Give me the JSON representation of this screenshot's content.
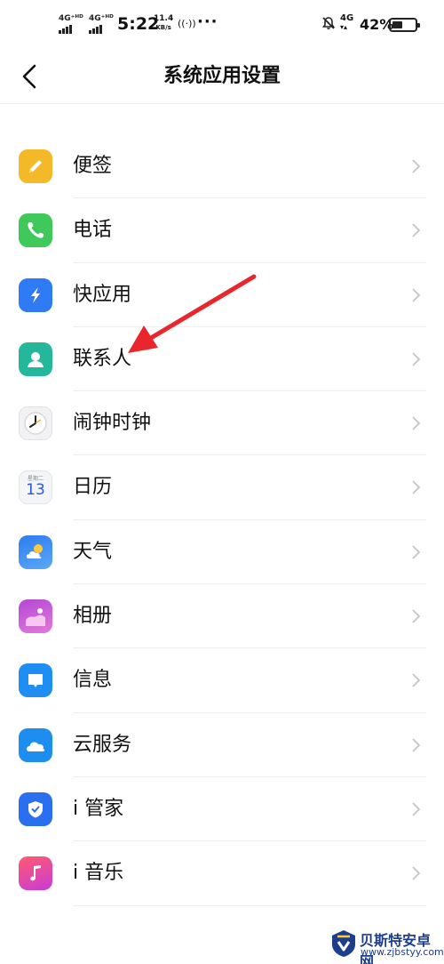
{
  "status": {
    "sim1": "4G⁺ᴴᴰ",
    "sim2": "4G⁺ᴴᴰ",
    "time": "5:22",
    "speed_value": "11.4",
    "speed_unit": "KB/s",
    "network": "4G",
    "battery": "42%"
  },
  "header": {
    "title": "系统应用设置"
  },
  "items": [
    {
      "label": "便签",
      "icon": "note-icon"
    },
    {
      "label": "电话",
      "icon": "phone-icon"
    },
    {
      "label": "快应用",
      "icon": "quick-app-icon"
    },
    {
      "label": "联系人",
      "icon": "contacts-icon"
    },
    {
      "label": "闹钟时钟",
      "icon": "clock-icon"
    },
    {
      "label": "日历",
      "icon": "calendar-icon",
      "icon_day": "13",
      "icon_weekday": "星期二"
    },
    {
      "label": "天气",
      "icon": "weather-icon"
    },
    {
      "label": "相册",
      "icon": "gallery-icon"
    },
    {
      "label": "信息",
      "icon": "messages-icon"
    },
    {
      "label": "云服务",
      "icon": "cloud-icon"
    },
    {
      "label": "i 管家",
      "icon": "shield-icon"
    },
    {
      "label": "i 音乐",
      "icon": "music-icon"
    }
  ],
  "watermark": {
    "name": "贝斯特安卓网",
    "url": "www.zjbstyy.com"
  },
  "colors": {
    "annotation_arrow": "#e8262b",
    "note": "#f3b928",
    "phone": "#3ec95a",
    "quick_app": "#2f7bf5",
    "contacts": "#25b79a",
    "weather": "#3f8ff0",
    "gallery": "#c05ad8",
    "messages": "#1e8ef2",
    "cloud": "#1d8df0",
    "guard": "#2a6ff0",
    "music": "#e8396f"
  }
}
